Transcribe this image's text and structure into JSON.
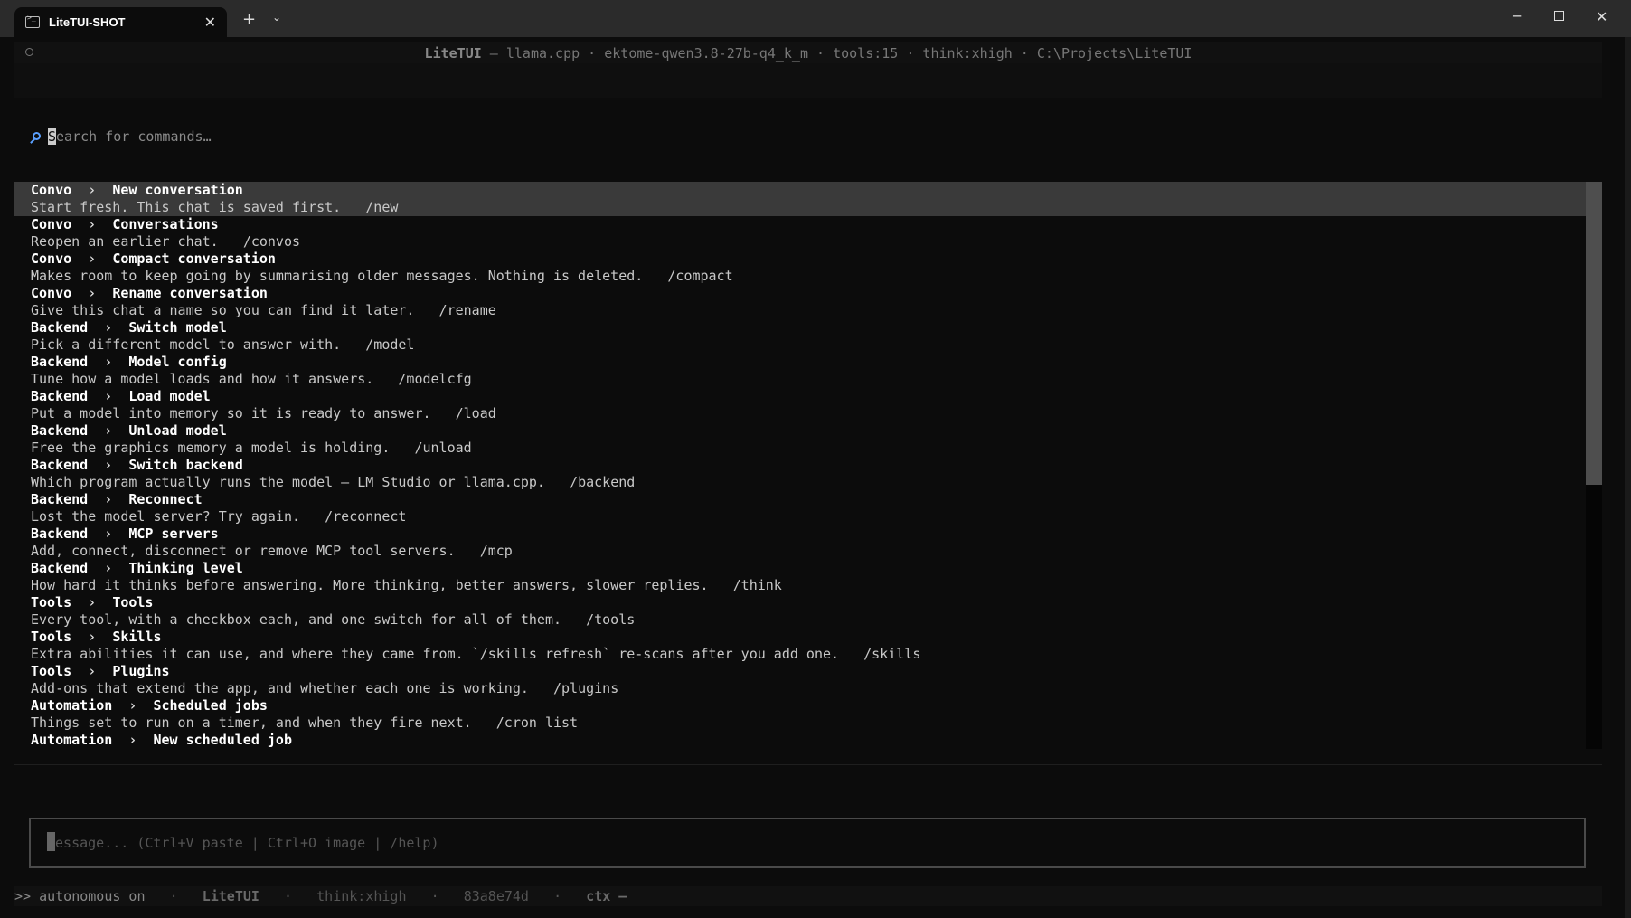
{
  "window": {
    "tab_title": "LiteTUI-SHOT",
    "new_tab": "+",
    "tab_dropdown": "⌄",
    "min": "─",
    "close": "✕"
  },
  "header": {
    "app": "LiteTUI",
    "details": " — llama.cpp · ektome-qwen3.8-27b-q4_k_m · tools:15 · think:xhigh · C:\\Projects\\LiteTUI"
  },
  "search": {
    "first_char": "S",
    "rest": "earch for commands…"
  },
  "commands": [
    {
      "group": "Convo",
      "name": "New conversation",
      "desc": "Start fresh. This chat is saved first.",
      "cmd": "/new"
    },
    {
      "group": "Convo",
      "name": "Conversations",
      "desc": "Reopen an earlier chat.",
      "cmd": "/convos"
    },
    {
      "group": "Convo",
      "name": "Compact conversation",
      "desc": "Makes room to keep going by summarising older messages. Nothing is deleted.",
      "cmd": "/compact"
    },
    {
      "group": "Convo",
      "name": "Rename conversation",
      "desc": "Give this chat a name so you can find it later.",
      "cmd": "/rename"
    },
    {
      "group": "Backend",
      "name": "Switch model",
      "desc": "Pick a different model to answer with.",
      "cmd": "/model"
    },
    {
      "group": "Backend",
      "name": "Model config",
      "desc": "Tune how a model loads and how it answers.",
      "cmd": "/modelcfg"
    },
    {
      "group": "Backend",
      "name": "Load model",
      "desc": "Put a model into memory so it is ready to answer.",
      "cmd": "/load"
    },
    {
      "group": "Backend",
      "name": "Unload model",
      "desc": "Free the graphics memory a model is holding.",
      "cmd": "/unload"
    },
    {
      "group": "Backend",
      "name": "Switch backend",
      "desc": "Which program actually runs the model — LM Studio or llama.cpp.",
      "cmd": "/backend"
    },
    {
      "group": "Backend",
      "name": "Reconnect",
      "desc": "Lost the model server? Try again.",
      "cmd": "/reconnect"
    },
    {
      "group": "Backend",
      "name": "MCP servers",
      "desc": "Add, connect, disconnect or remove MCP tool servers.",
      "cmd": "/mcp"
    },
    {
      "group": "Backend",
      "name": "Thinking level",
      "desc": "How hard it thinks before answering. More thinking, better answers, slower replies.",
      "cmd": "/think"
    },
    {
      "group": "Tools",
      "name": "Tools",
      "desc": "Every tool, with a checkbox each, and one switch for all of them.",
      "cmd": "/tools"
    },
    {
      "group": "Tools",
      "name": "Skills",
      "desc": "Extra abilities it can use, and where they came from. `/skills refresh` re-scans after you add one.",
      "cmd": "/skills"
    },
    {
      "group": "Tools",
      "name": "Plugins",
      "desc": "Add-ons that extend the app, and whether each one is working.",
      "cmd": "/plugins"
    },
    {
      "group": "Automation",
      "name": "Scheduled jobs",
      "desc": "Things set to run on a timer, and when they fire next.",
      "cmd": "/cron list"
    },
    {
      "group": "Automation",
      "name": "New scheduled job",
      "desc": "",
      "cmd": ""
    }
  ],
  "separator": "›",
  "input": {
    "placeholder": "Message... (Ctrl+V paste | Ctrl+O image | /help)"
  },
  "footer": {
    "mode": ">> autonomous on",
    "app": "LiteTUI",
    "think": "think:xhigh",
    "hash": "83a8e74d",
    "ctx": "ctx –",
    "dot": "·"
  }
}
